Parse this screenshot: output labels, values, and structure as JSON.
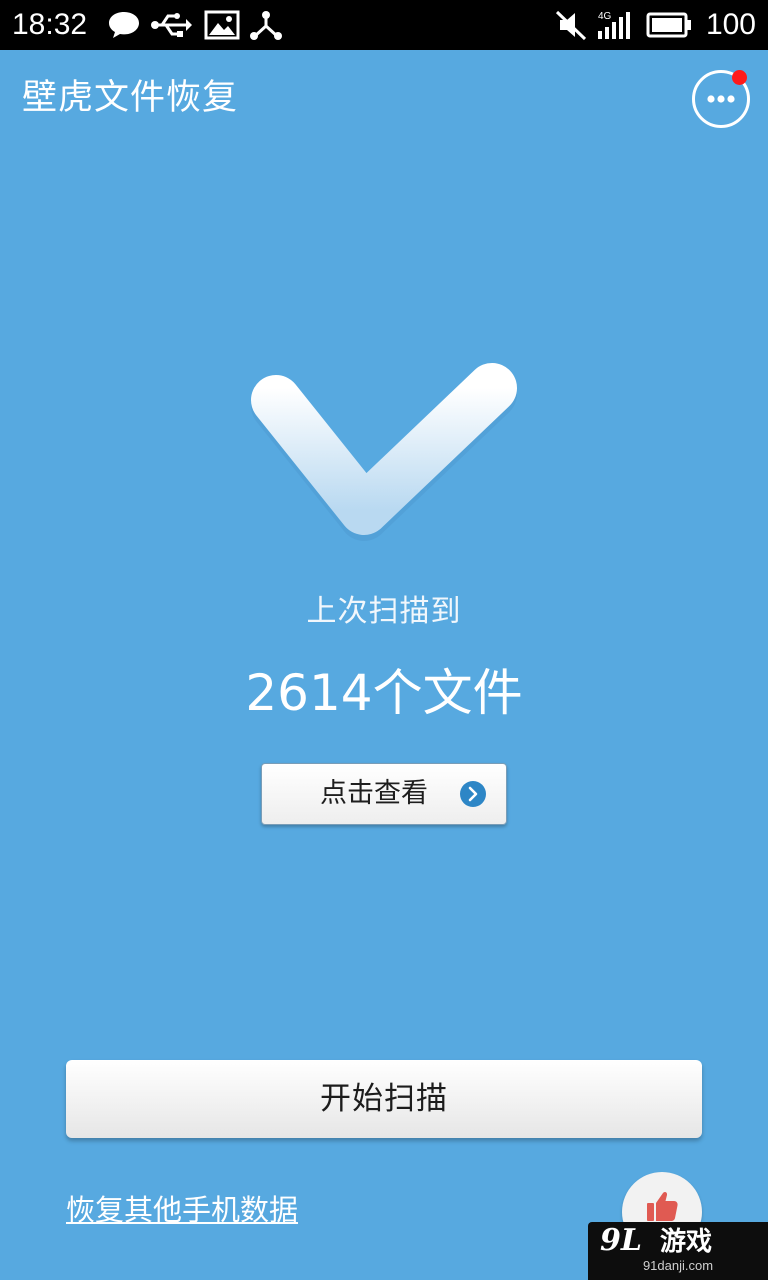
{
  "status_bar": {
    "time": "18:32",
    "battery_level": "100",
    "network_type": "4G",
    "icons": [
      "chat-bubble-icon",
      "usb-icon",
      "image-icon",
      "share-icon",
      "mute-icon",
      "signal-icon",
      "battery-icon"
    ]
  },
  "app_bar": {
    "title": "壁虎文件恢复",
    "more_icon": "more-dots-icon",
    "has_notification": true
  },
  "result": {
    "icon": "checkmark-icon",
    "label": "上次扫描到",
    "count": "2614个文件",
    "view_button_label": "点击查看",
    "view_button_icon": "chevron-right-icon"
  },
  "actions": {
    "scan_button_label": "开始扫描",
    "recover_other_link": "恢复其他手机数据",
    "like_icon": "thumbs-up-icon"
  },
  "watermark": {
    "logo_number": "9L",
    "logo_text": "游戏",
    "url": "91danji.com"
  },
  "colors": {
    "background": "#57a9e0",
    "status_bar": "#000000",
    "button_surface": "#f4f4f4",
    "accent_blue": "#2d86c6",
    "notification": "#ff1a1a",
    "like": "#e05a52"
  }
}
